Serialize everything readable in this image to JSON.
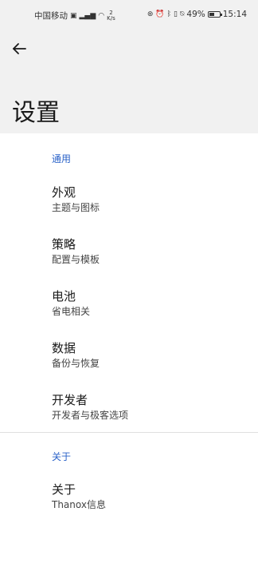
{
  "status_bar": {
    "carrier": "中国移动",
    "net_speed_value": "2",
    "net_speed_unit": "K/s",
    "battery": "49%",
    "battery_level": 0.49,
    "time": "15:14"
  },
  "header": {
    "title": "设置"
  },
  "sections": [
    {
      "header": "通用",
      "items": [
        {
          "title": "外观",
          "subtitle": "主题与图标"
        },
        {
          "title": "策略",
          "subtitle": "配置与模板"
        },
        {
          "title": "电池",
          "subtitle": "省电相关"
        },
        {
          "title": "数据",
          "subtitle": "备份与恢复"
        },
        {
          "title": "开发者",
          "subtitle": "开发者与极客选项"
        }
      ]
    },
    {
      "header": "关于",
      "items": [
        {
          "title": "关于",
          "subtitle": "Thanox信息"
        }
      ]
    }
  ]
}
